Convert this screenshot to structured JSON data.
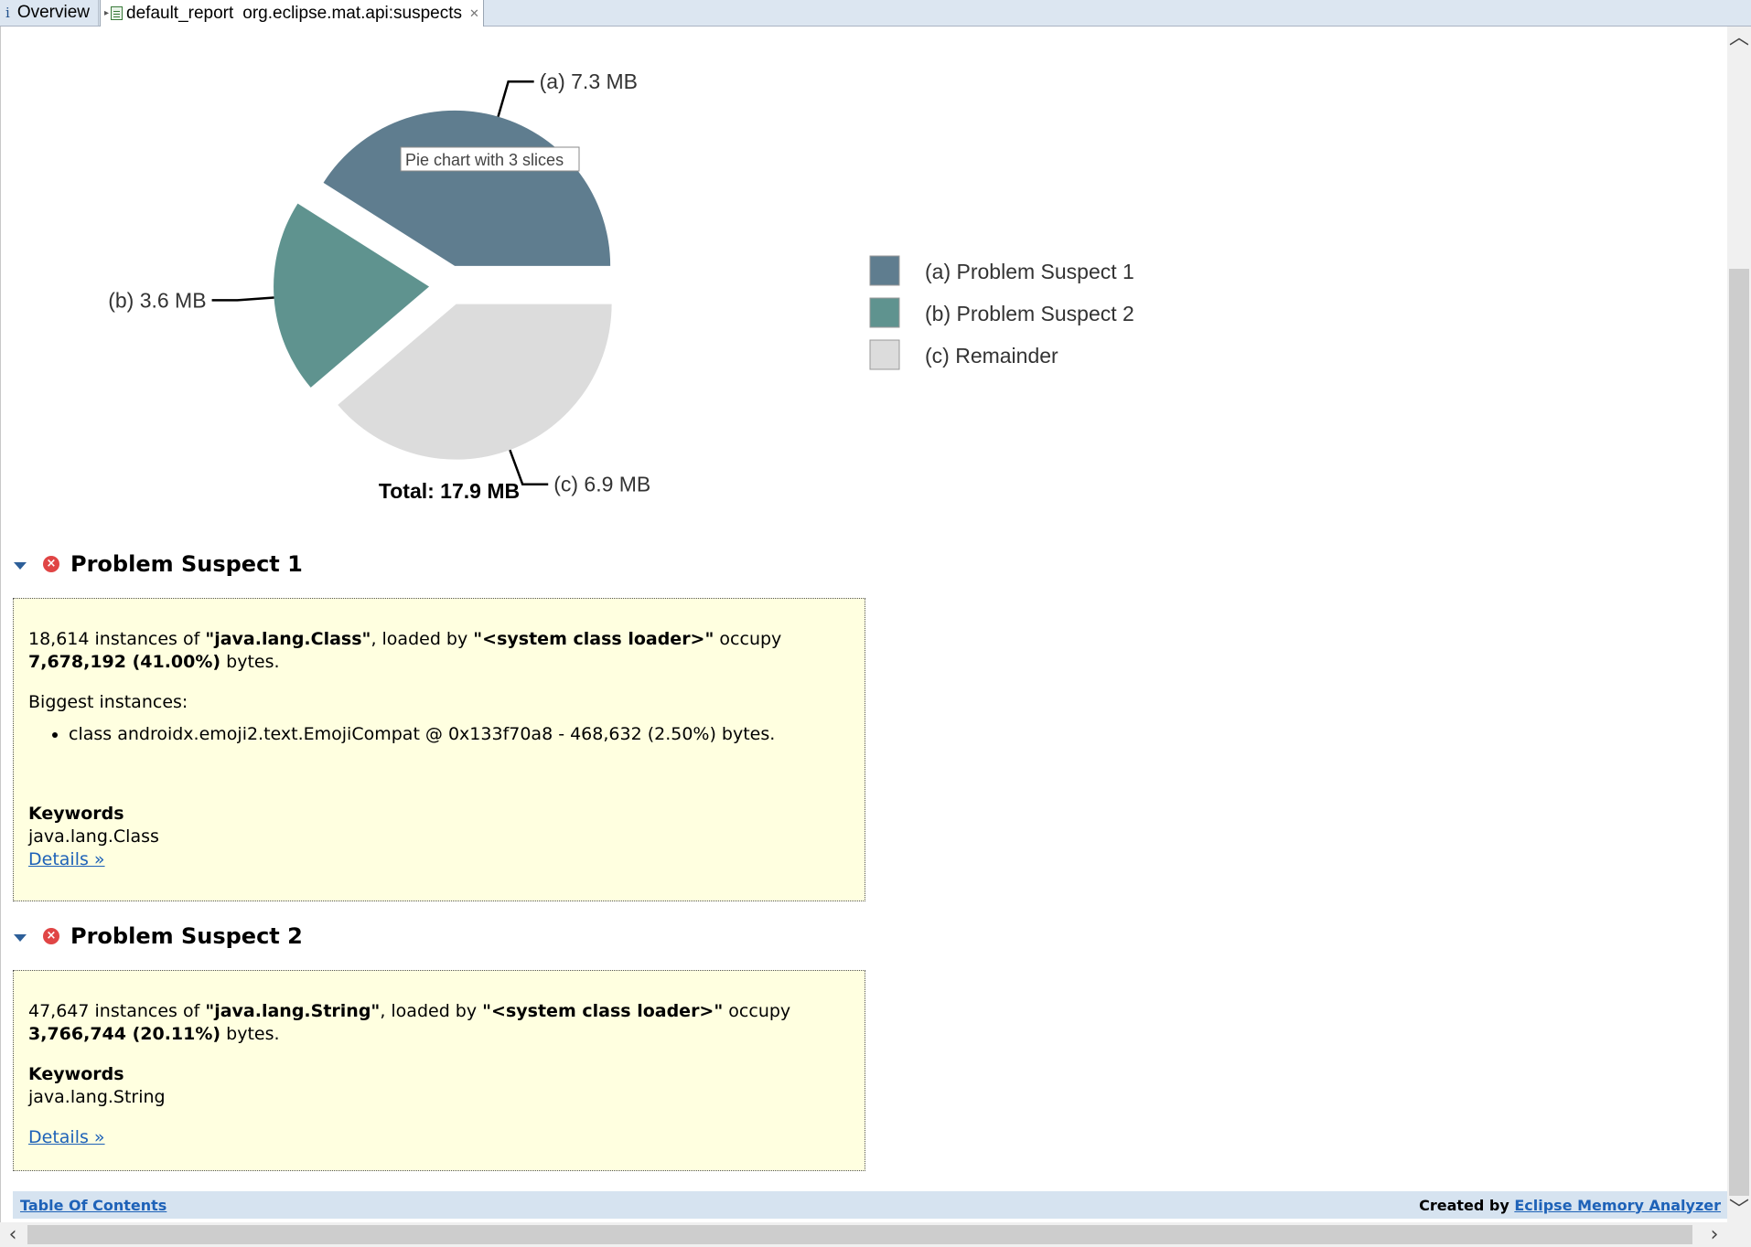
{
  "tabs": [
    {
      "icon": "info-icon",
      "label": "Overview"
    },
    {
      "icon": "report-icon",
      "label": "default_report",
      "label2": "org.eclipse.mat.api:suspects"
    }
  ],
  "chart_data": {
    "type": "pie",
    "title": "",
    "tooltip": "Pie chart with 3 slices",
    "total_label": "Total: 17.9 MB",
    "slices": [
      {
        "key": "(a)",
        "name": "Problem Suspect 1",
        "value": 7.3,
        "label": "7.3 MB",
        "color": "#5f7d8f"
      },
      {
        "key": "(b)",
        "name": "Problem Suspect 2",
        "value": 3.6,
        "label": "3.6 MB",
        "color": "#5f938f"
      },
      {
        "key": "(c)",
        "name": "Remainder",
        "value": 6.9,
        "label": "6.9 MB",
        "color": "#dcdcdc"
      }
    ],
    "legend_position": "right"
  },
  "suspects": [
    {
      "title": "Problem Suspect 1",
      "count": "18,614",
      "t1": " instances of ",
      "cls": "\"java.lang.Class\"",
      "t2": ", loaded by ",
      "loader": "\"<system class loader>\"",
      "t3": " occupy",
      "bytes": "7,678,192 (41.00%)",
      "t4": " bytes.",
      "biggest_label": "Biggest instances:",
      "biggest": [
        "class androidx.emoji2.text.EmojiCompat @ 0x133f70a8 - 468,632 (2.50%) bytes."
      ],
      "keywords_label": "Keywords",
      "keyword": "java.lang.Class",
      "details": "Details »"
    },
    {
      "title": "Problem Suspect 2",
      "count": "47,647",
      "t1": " instances of ",
      "cls": "\"java.lang.String\"",
      "t2": ", loaded by ",
      "loader": "\"<system class loader>\"",
      "t3": " occupy",
      "bytes": "3,766,744 (20.11%)",
      "t4": " bytes.",
      "keywords_label": "Keywords",
      "keyword": "java.lang.String",
      "details": "Details »"
    }
  ],
  "footer": {
    "toc": "Table Of Contents",
    "created_by": "Created by ",
    "mat": "Eclipse Memory Analyzer"
  }
}
